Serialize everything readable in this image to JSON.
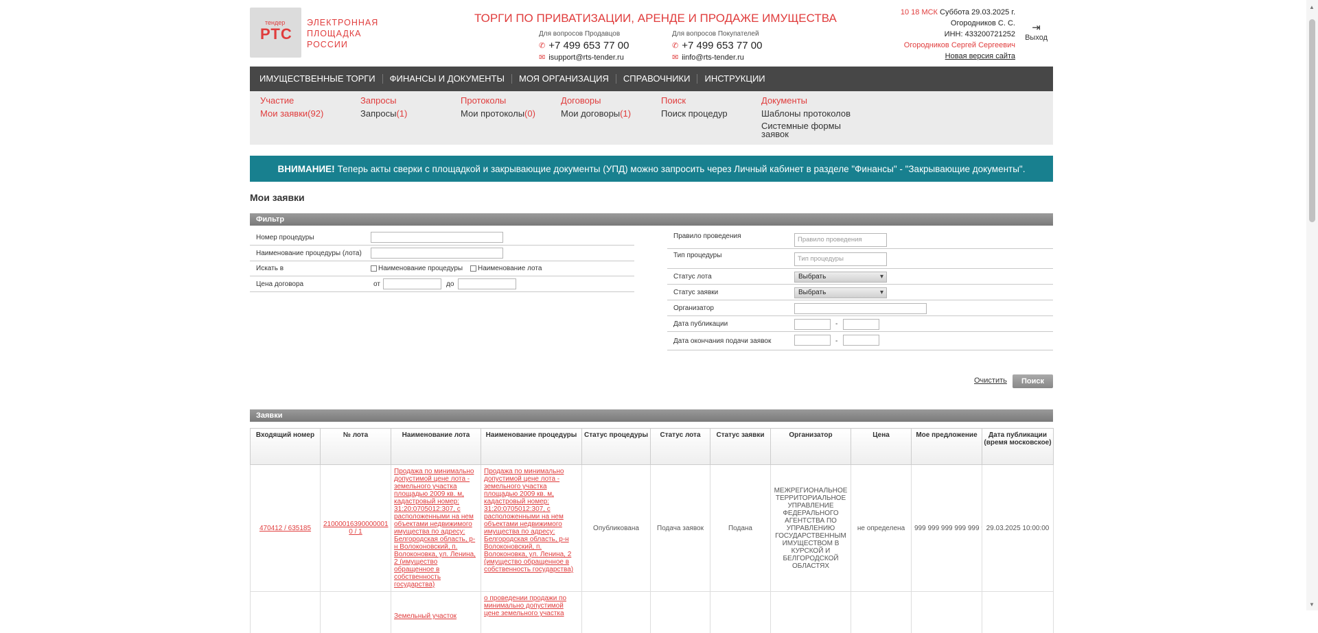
{
  "header": {
    "logo_small": "тендер",
    "logo_main": "РТС",
    "logo_text": [
      "ЭЛЕКТРОННАЯ",
      "ПЛОЩАДКА",
      "РОССИИ"
    ],
    "title": "ТОРГИ ПО ПРИВАТИЗАЦИИ, АРЕНДЕ И ПРОДАЖЕ ИМУЩЕСТВА",
    "sellers": {
      "label": "Для вопросов Продавцов",
      "phone": "+7 499 653 77 00",
      "email": "isupport@rts-tender.ru"
    },
    "buyers": {
      "label": "Для вопросов Покупателей",
      "phone": "+7 499 653 77 00",
      "email": "iinfo@rts-tender.ru"
    },
    "time": "10 18 МСК",
    "date": "Суббота 29.03.2025 г.",
    "user_short": "Огородников С. С.",
    "inn": "ИНН: 433200721252",
    "user_full": "Огородников Сергей Сергеевич",
    "new_version": "Новая версия сайта",
    "exit": "Выход",
    "exit_icon": "logout-icon"
  },
  "nav": [
    "ИМУЩЕСТВЕННЫЕ ТОРГИ",
    "ФИНАНСЫ И ДОКУМЕНТЫ",
    "МОЯ ОРГАНИЗАЦИЯ",
    "СПРАВОЧНИКИ",
    "ИНСТРУКЦИИ"
  ],
  "subnav": {
    "participation": {
      "title": "Участие",
      "link": "Мои заявки",
      "count": "(92)"
    },
    "requests": {
      "title": "Запросы",
      "link": "Запросы",
      "count": "(1)"
    },
    "protocols": {
      "title": "Протоколы",
      "link": "Мои протоколы",
      "count": "(0)"
    },
    "contracts": {
      "title": "Договоры",
      "link": "Мои договоры",
      "count": "(1)"
    },
    "search": {
      "title": "Поиск",
      "link": "Поиск процедур"
    },
    "documents": {
      "title": "Документы",
      "link1": "Шаблоны протоколов",
      "link2": "Системные формы заявок"
    }
  },
  "banner": {
    "bold": "ВНИМАНИЕ!",
    "text": "Теперь акты сверки с площадкой и закрывающие документы (УПД) можно запросить через Личный кабинет в разделе \"Финансы\" - \"Закрывающие документы\"."
  },
  "page_title": "Мои заявки",
  "filter": {
    "title": "Фильтр",
    "proc_number": "Номер процедуры",
    "proc_name": "Наименование процедуры (лота)",
    "search_in": "Искать в",
    "chk_proc": "Наименование процедуры",
    "chk_lot": "Наименование лота",
    "price": "Цена договора",
    "from": "от",
    "to": "до",
    "rule": "Правило проведения",
    "rule_ph": "Правило проведения",
    "type": "Тип процедуры",
    "type_ph": "Тип процедуры",
    "lot_status": "Статус лота",
    "app_status": "Статус заявки",
    "select": "Выбрать",
    "organizer": "Организатор",
    "pub_date": "Дата публикации",
    "end_date": "Дата окончания подачи заявок",
    "dash": "-",
    "clear": "Очистить",
    "search": "Поиск"
  },
  "apps": {
    "title": "Заявки",
    "columns": [
      "Входящий номер",
      "№ лота",
      "Наименование лота",
      "Наименование процедуры",
      "Статус процедуры",
      "Статус лота",
      "Статус заявки",
      "Организатор",
      "Цена",
      "Мое предложение",
      "Дата публикации (время московское)"
    ],
    "row1": {
      "incoming": "470412 / 635185",
      "lot_no": "21000016390000001 0 / 1",
      "lot_name": "Продажа по минимально допустимой цене лота - земельного участка площадью 2009 кв. м, кадастровый номер: 31:20:0705012:307, с расположенными на нем объектами недвижимого имущества по адресу: Белгородская область, р-н Волоконовский, п. Волоконовка, ул. Ленина, 2 (имущество обращенное в собственность государства)",
      "proc_name": "Продажа по минимально допустимой цене лота - земельного участка площадью 2009 кв. м, кадастровый номер: 31:20:0705012:307, с расположенными на нем объектами недвижимого имущества по адресу: Белгородская область, р-н Волоконовский, п. Волоконовка, ул. Ленина, 2 (имущество обращенное в собственность государства)",
      "proc_status": "Опубликована",
      "lot_status": "Подача заявок",
      "app_status": "Подана",
      "organizer": "МЕЖРЕГИОНАЛЬНОЕ ТЕРРИТОРИАЛЬНОЕ УПРАВЛЕНИЕ ФЕДЕРАЛЬНОГО АГЕНТСТВА ПО УПРАВЛЕНИЮ ГОСУДАРСТВЕННЫМ ИМУЩЕСТВОМ В КУРСКОЙ И БЕЛГОРОДСКОЙ ОБЛАСТЯХ",
      "price": "не определена",
      "offer": "999 999 999 999 999 9",
      "pub_date": "29.03.2025 10:00:00"
    },
    "row2": {
      "lot_name": "Земельный участок",
      "proc_name": "о проведении продажи по минимально допустимой цене земельного участка"
    }
  }
}
